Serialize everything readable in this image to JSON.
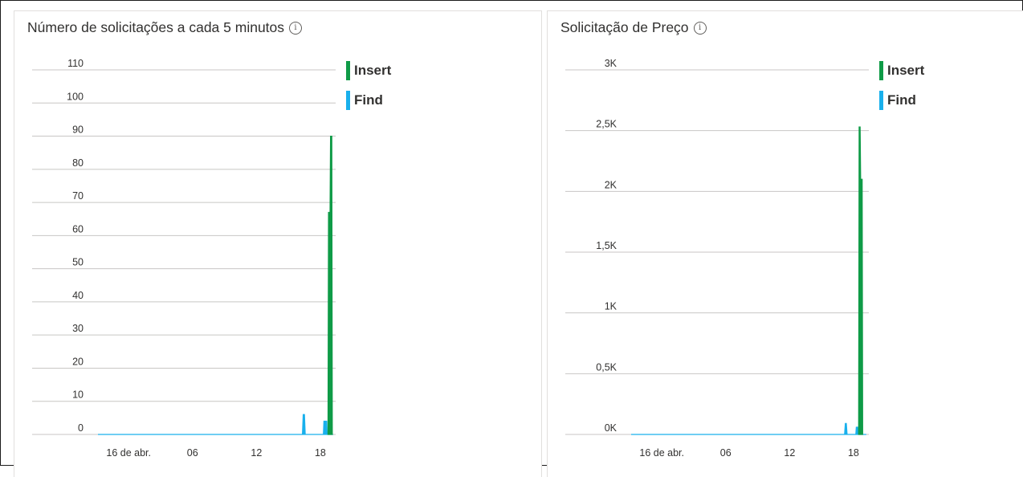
{
  "colors": {
    "insert": "#0f9b47",
    "find": "#19b0ec",
    "grid": "#c8c6c4"
  },
  "info_icon_glyph": "i",
  "chart_data": [
    {
      "type": "area",
      "title": "Número de solicitações a cada 5 minutos",
      "xlabel": "",
      "ylabel": "",
      "ylim": [
        0,
        110
      ],
      "yticks": [
        0,
        10,
        20,
        30,
        40,
        50,
        60,
        70,
        80,
        90,
        100,
        110
      ],
      "ytick_labels": [
        "0",
        "10",
        "20",
        "30",
        "40",
        "50",
        "60",
        "70",
        "80",
        "90",
        "100",
        "110"
      ],
      "xticks": [
        {
          "day": 16.0,
          "label": "16 de abr."
        },
        {
          "day": 16.25,
          "label": "06"
        },
        {
          "day": 16.5,
          "label": "12"
        },
        {
          "day": 16.75,
          "label": "18"
        }
      ],
      "xlim": [
        15.88,
        16.81
      ],
      "grid": true,
      "legend_position": "right",
      "series": [
        {
          "name": "Insert",
          "color_key": "insert",
          "points": [
            [
              16.78,
              0
            ],
            [
              16.782,
              67
            ],
            [
              16.788,
              67
            ],
            [
              16.79,
              90
            ],
            [
              16.795,
              90
            ],
            [
              16.797,
              0
            ]
          ]
        },
        {
          "name": "Find",
          "color_key": "find",
          "points": [
            [
              15.88,
              0
            ],
            [
              16.68,
              0
            ],
            [
              16.683,
              6
            ],
            [
              16.688,
              6
            ],
            [
              16.691,
              0
            ],
            [
              16.762,
              0
            ],
            [
              16.764,
              4
            ],
            [
              16.775,
              4
            ],
            [
              16.777,
              0
            ],
            [
              16.8,
              0
            ]
          ]
        }
      ]
    },
    {
      "type": "area",
      "title": "Solicitação de Preço",
      "xlabel": "",
      "ylabel": "",
      "ylim": [
        0,
        3000
      ],
      "yticks": [
        0,
        500,
        1000,
        1500,
        2000,
        2500,
        3000
      ],
      "ytick_labels": [
        "0K",
        "0,5K",
        "1K",
        "1,5K",
        "2K",
        "2,5K",
        "3K"
      ],
      "xticks": [
        {
          "day": 16.0,
          "label": "16 de abr."
        },
        {
          "day": 16.25,
          "label": "06"
        },
        {
          "day": 16.5,
          "label": "12"
        },
        {
          "day": 16.75,
          "label": "18"
        }
      ],
      "xlim": [
        15.88,
        16.81
      ],
      "grid": true,
      "legend_position": "right",
      "series": [
        {
          "name": "Insert",
          "color_key": "insert",
          "points": [
            [
              16.77,
              0
            ],
            [
              16.772,
              2530
            ],
            [
              16.776,
              2530
            ],
            [
              16.778,
              2100
            ],
            [
              16.784,
              2100
            ],
            [
              16.786,
              0
            ]
          ]
        },
        {
          "name": "Find",
          "color_key": "find",
          "points": [
            [
              15.88,
              0
            ],
            [
              16.715,
              0
            ],
            [
              16.718,
              90
            ],
            [
              16.722,
              90
            ],
            [
              16.725,
              0
            ],
            [
              16.759,
              0
            ],
            [
              16.761,
              60
            ],
            [
              16.767,
              60
            ],
            [
              16.769,
              0
            ],
            [
              16.8,
              0
            ]
          ]
        }
      ]
    }
  ]
}
